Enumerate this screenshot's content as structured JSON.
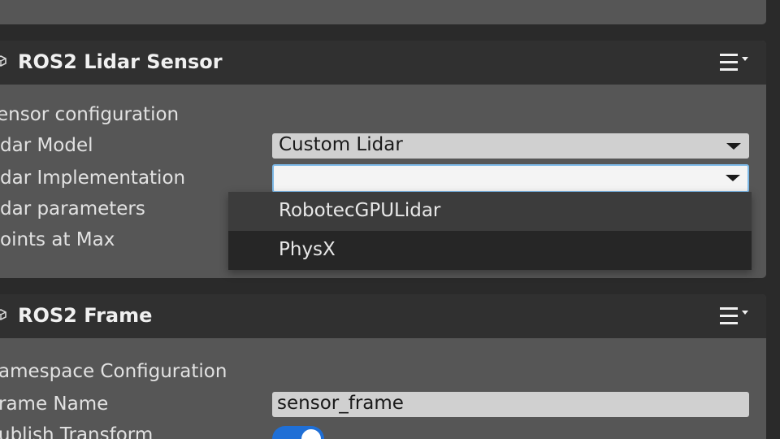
{
  "lidar_component": {
    "title": "ROS2 Lidar Sensor",
    "icon": "component-icon",
    "menu_icon": "hamburger-menu-icon",
    "section_label": "ensor configuration",
    "properties": [
      {
        "label": "dar Model",
        "value": "Custom Lidar"
      },
      {
        "label": "dar Implementation",
        "value": ""
      },
      {
        "label": "dar parameters"
      },
      {
        "label": "oints at Max"
      }
    ],
    "dropdown": {
      "options": [
        "RobotecGPULidar",
        "PhysX"
      ],
      "hovered_index": 1
    }
  },
  "frame_component": {
    "title": "ROS2 Frame",
    "icon": "component-icon",
    "menu_icon": "hamburger-menu-icon",
    "section_label": "amespace Configuration",
    "properties": [
      {
        "label": "rame Name",
        "value": "sensor_frame"
      },
      {
        "label": "ublish Transform",
        "value": true
      }
    ]
  },
  "colors": {
    "panel_bg": "#565656",
    "header_bg": "#303030",
    "toggle_on": "#1f6fd6",
    "focus_border": "#7db9e8"
  }
}
